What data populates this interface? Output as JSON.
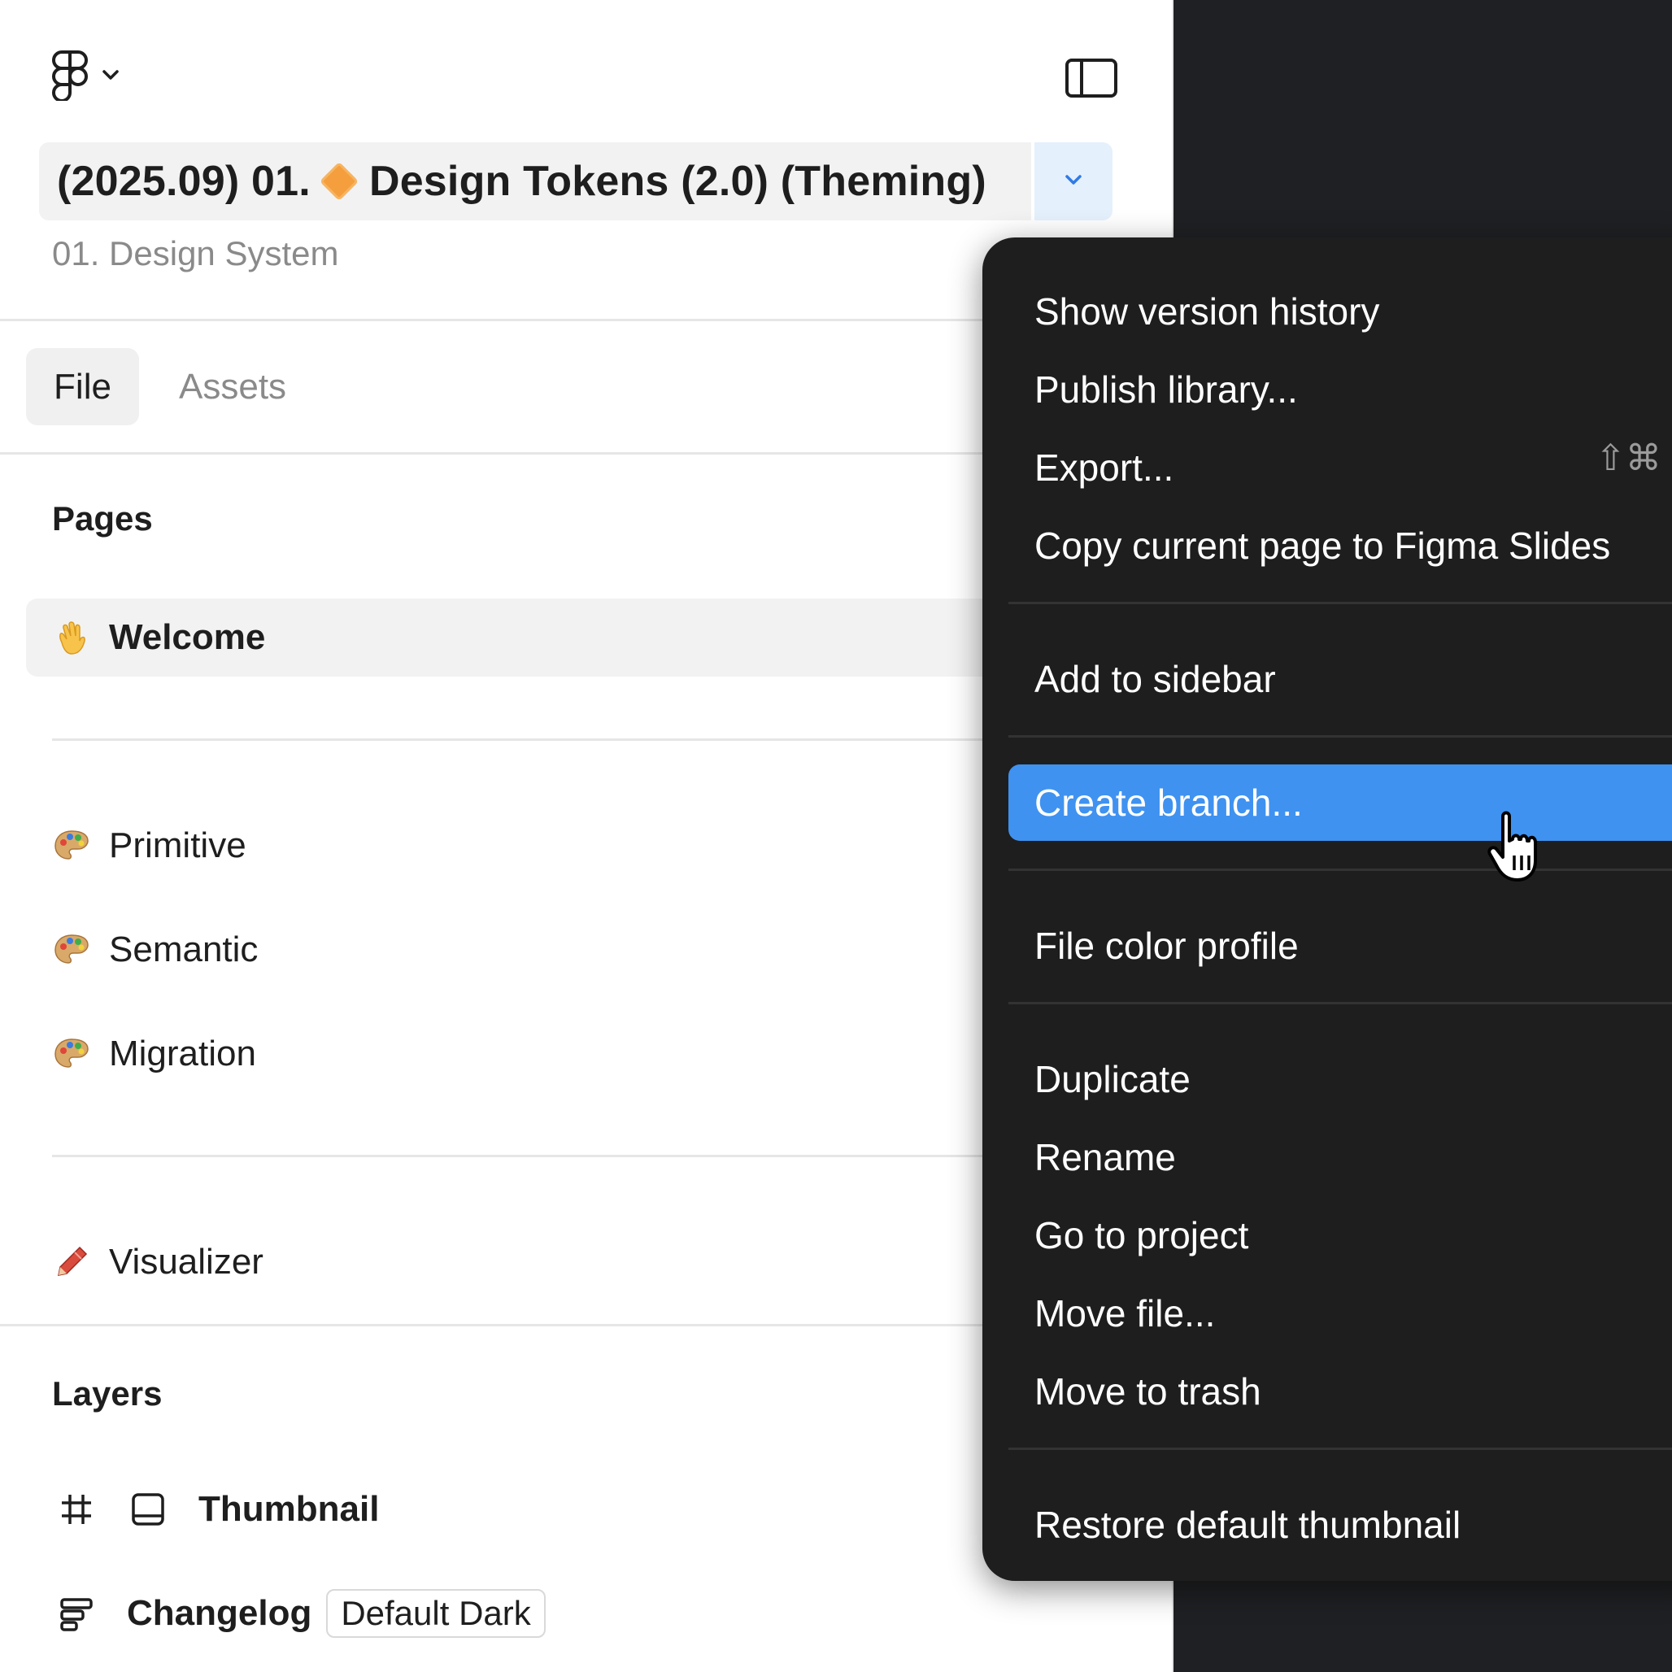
{
  "header": {
    "file_title_prefix": "(2025.09) 01.",
    "file_title_rest": "Design Tokens (2.0) (Theming)",
    "project": "01. Design System"
  },
  "tabs": {
    "file": "File",
    "assets": "Assets"
  },
  "pages": {
    "label": "Pages",
    "items": [
      {
        "name": "Welcome",
        "icon": "waving-hand"
      },
      {
        "name": "Primitive",
        "icon": "artist-palette"
      },
      {
        "name": "Semantic",
        "icon": "artist-palette"
      },
      {
        "name": "Migration",
        "icon": "artist-palette"
      },
      {
        "name": "Visualizer",
        "icon": "crayon"
      }
    ]
  },
  "layers": {
    "label": "Layers",
    "items": [
      {
        "name": "Thumbnail",
        "icon": "frame-hash"
      },
      {
        "name": "Changelog",
        "icon": "auto-layout",
        "badge": "Default Dark"
      }
    ]
  },
  "menu": {
    "items": [
      "Show version history",
      "Publish library...",
      "Export...",
      "Copy current page to Figma Slides",
      "Add to sidebar",
      "Create branch...",
      "File color profile",
      "Duplicate",
      "Rename",
      "Go to project",
      "Move file...",
      "Move to trash",
      "Restore default thumbnail"
    ],
    "export_shortcut": "⇧⌘",
    "active_item": "Create branch..."
  },
  "colors": {
    "menu_bg": "#1e1e1e",
    "menu_highlight": "#3f92f0",
    "canvas_bg": "#1f2023",
    "title_accent": "#f59e3d"
  }
}
